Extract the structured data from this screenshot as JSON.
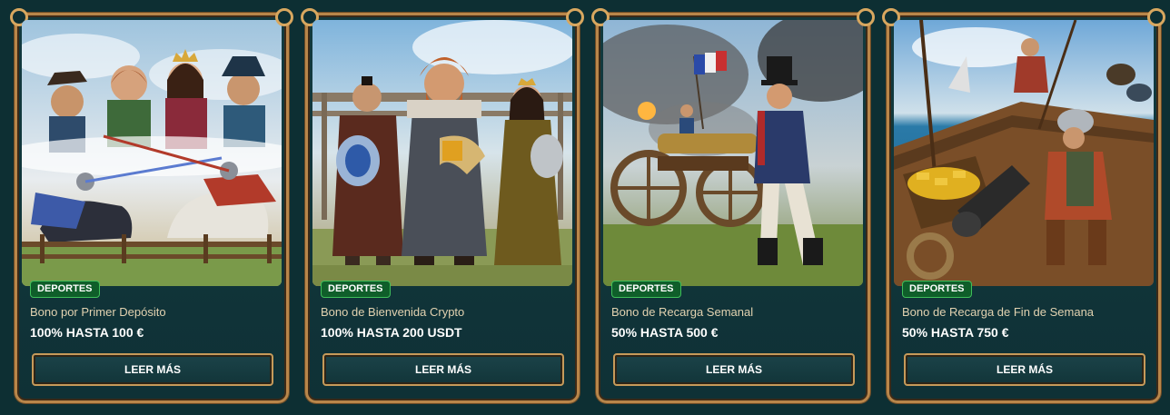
{
  "cards": [
    {
      "badge": "DEPORTES",
      "subtitle": "Bono por Primer Depósito",
      "amount": "100% HASTA 100 €",
      "button": "LEER MÁS",
      "art": "medieval-joust-illustration"
    },
    {
      "badge": "DEPORTES",
      "subtitle": "Bono de Bienvenida Crypto",
      "amount": "100% HASTA 200 USDT",
      "button": "LEER MÁS",
      "art": "viking-trophy-illustration"
    },
    {
      "badge": "DEPORTES",
      "subtitle": "Bono de Recarga Semanal",
      "amount": "50% HASTA 500 €",
      "button": "LEER MÁS",
      "art": "napoleonic-cannon-illustration"
    },
    {
      "badge": "DEPORTES",
      "subtitle": "Bono de Recarga de Fin de Semana",
      "amount": "50% HASTA 750 €",
      "button": "LEER MÁS",
      "art": "pirate-ship-treasure-illustration"
    }
  ],
  "colors": {
    "background": "#0d2f33",
    "card_border": "#b9864a",
    "badge_bg": "#0f5e2a",
    "badge_border": "#3fbf5a",
    "subtitle_text": "#e2d2b0"
  }
}
